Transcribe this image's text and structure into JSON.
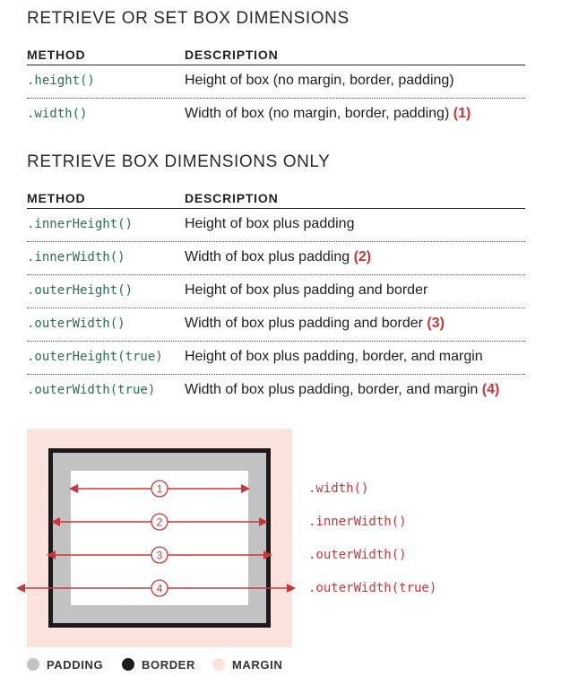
{
  "section1": {
    "title": "RETRIEVE OR SET BOX DIMENSIONS",
    "header": {
      "method": "METHOD",
      "description": "DESCRIPTION"
    },
    "rows": [
      {
        "method": ".height()",
        "description": "Height of box (no margin, border, padding)",
        "ref": ""
      },
      {
        "method": ".width()",
        "description": "Width of box (no margin, border, padding)",
        "ref": "(1)"
      }
    ]
  },
  "section2": {
    "title": "RETRIEVE BOX DIMENSIONS ONLY",
    "header": {
      "method": "METHOD",
      "description": "DESCRIPTION"
    },
    "rows": [
      {
        "method": ".innerHeight()",
        "description": "Height of box plus padding",
        "ref": ""
      },
      {
        "method": ".innerWidth()",
        "description": "Width of box plus padding",
        "ref": "(2)"
      },
      {
        "method": ".outerHeight()",
        "description": "Height of box plus padding and border",
        "ref": ""
      },
      {
        "method": ".outerWidth()",
        "description": "Width of box plus padding and border",
        "ref": "(3)"
      },
      {
        "method": ".outerHeight(true)",
        "description": "Height of box plus padding, border, and margin",
        "ref": ""
      },
      {
        "method": ".outerWidth(true)",
        "description": "Width of box plus padding, border, and margin",
        "ref": "(4)"
      }
    ]
  },
  "diagram": {
    "arrows": [
      {
        "number": "1",
        "label": ".width()"
      },
      {
        "number": "2",
        "label": ".innerWidth()"
      },
      {
        "number": "3",
        "label": ".outerWidth()"
      },
      {
        "number": "4",
        "label": ".outerWidth(true)"
      }
    ]
  },
  "legend": [
    {
      "label": "PADDING",
      "color": "#c2c2c2"
    },
    {
      "label": "BORDER",
      "color": "#1a1a1a"
    },
    {
      "label": "MARGIN",
      "color": "#f9e3dc"
    }
  ],
  "colors": {
    "accent": "#c6363a",
    "code": "#2c6e54"
  }
}
